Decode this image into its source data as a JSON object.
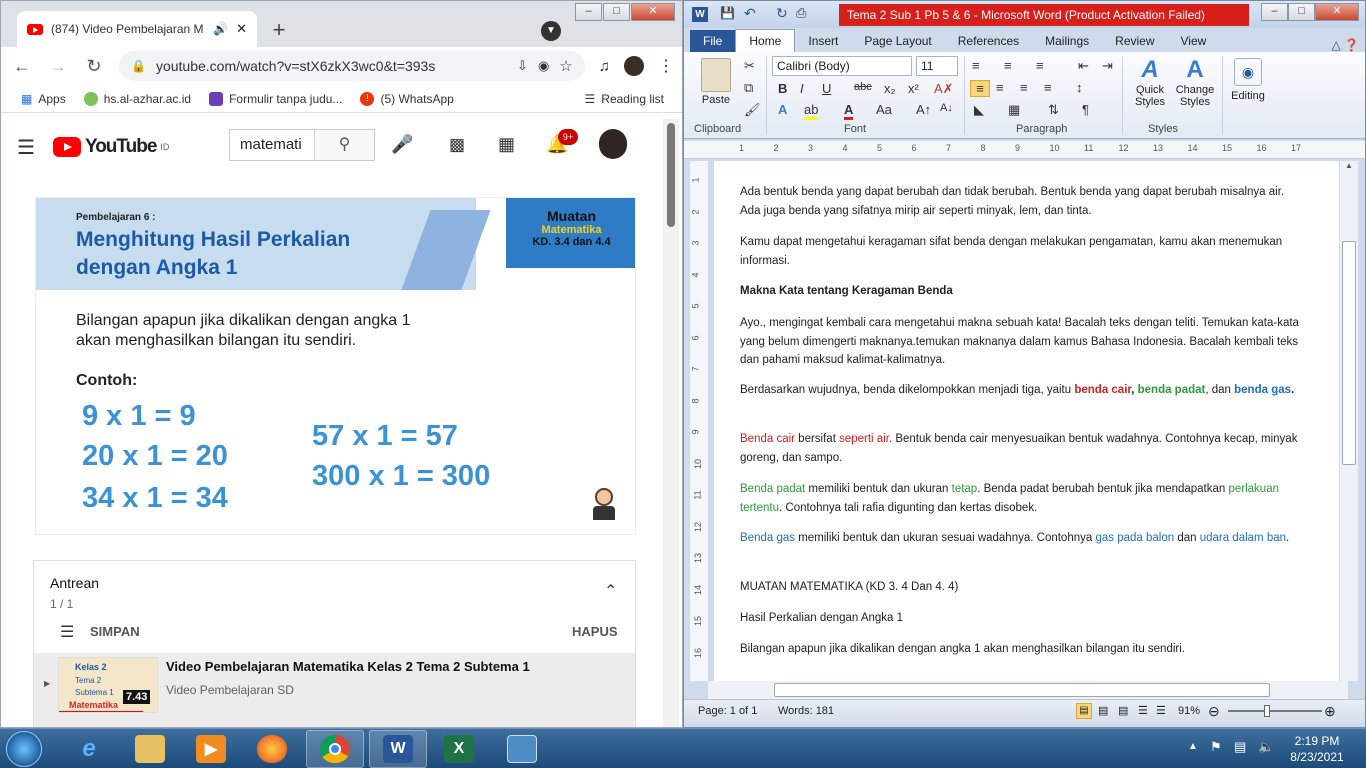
{
  "chrome": {
    "tab_title": "(874) Video Pembelajaran M",
    "new_tab": "+",
    "url": "youtube.com/watch?v=stX6zkX3wc0&t=393s",
    "bookmarks": [
      "Apps",
      "hs.al-azhar.ac.id",
      "Formulir tanpa judu...",
      "(5) WhatsApp"
    ],
    "reading_list": "Reading list",
    "window_controls": [
      "–",
      "□",
      "✕"
    ]
  },
  "youtube": {
    "logo_text": "YouTube",
    "region": "ID",
    "search_value": "matemati",
    "notif_count": "9+",
    "slide": {
      "kicker": "Pembelajaran 6 :",
      "title_line1": "Menghitung Hasil Perkalian",
      "title_line2": "dengan Angka 1",
      "muatan": "Muatan",
      "subject": "Matematika",
      "kd": "KD. 3.4 dan 4.4",
      "rule_line1": "Bilangan apapun jika dikalikan dengan angka 1",
      "rule_line2": "akan menghasilkan bilangan itu sendiri.",
      "contoh": "Contoh:",
      "examples_left": [
        "9 x 1 = 9",
        "20 x 1 = 20",
        "34 x 1 = 34"
      ],
      "examples_right": [
        "57 x 1 = 57",
        "300 x 1 = 300"
      ]
    },
    "queue": {
      "title": "Antrean",
      "position": "1 / 1",
      "save": "SIMPAN",
      "clear": "HAPUS",
      "item_title": "Video Pembelajaran Matematika Kelas 2 Tema 2 Subtema 1",
      "item_channel": "Video Pembelajaran SD",
      "item_duration": "7.43",
      "thumb_lines": [
        "Kelas 2",
        "Tema 2",
        "Subtema 1",
        "Matematika"
      ]
    }
  },
  "word": {
    "title": "Tema 2 Sub 1 Pb 5 & 6  -  Microsoft Word (Product Activation Failed)",
    "tabs": [
      "File",
      "Home",
      "Insert",
      "Page Layout",
      "References",
      "Mailings",
      "Review",
      "View"
    ],
    "font_name": "Calibri (Body)",
    "font_size": "11",
    "groups": [
      "Clipboard",
      "Font",
      "Paragraph",
      "Styles"
    ],
    "paste": "Paste",
    "quick_styles": [
      "Quick",
      "Styles"
    ],
    "change_styles": [
      "Change",
      "Styles"
    ],
    "editing": "Editing",
    "ruler_numbers": [
      "1",
      "2",
      "3",
      "4",
      "5",
      "6",
      "7",
      "8",
      "9",
      "10",
      "11",
      "12",
      "13",
      "14",
      "15",
      "16",
      "17"
    ],
    "vruler_numbers": [
      "1",
      "2",
      "3",
      "4",
      "5",
      "6",
      "7",
      "8",
      "9",
      "10",
      "11",
      "12",
      "13",
      "14",
      "15",
      "16"
    ],
    "doc": {
      "p1": "Ada bentuk benda yang dapat berubah dan tidak berubah. Bentuk benda yang dapat berubah misalnya air. Ada juga benda yang sifatnya mirip air seperti minyak, lem, dan tinta.",
      "p2": "Kamu dapat mengetahui keragaman sifat benda dengan melakukan pengamatan, kamu akan menemukan informasi.",
      "heading": "Makna Kata tentang Keragaman Benda",
      "p3": "Ayo., mengingat kembali cara mengetahui makna sebuah kata! Bacalah teks dengan teliti. Temukan kata-kata  yang belum dimengerti maknanya.temukan  maknanya dalam kamus Bahasa Indonesia. Bacalah kembali teks dan pahami maksud kalimat-kalimatnya.",
      "p4a": "Berdasarkan wujudnya, benda dikelompokkan menjadi tiga, yaitu ",
      "p4_cair": "benda cair",
      "p4_comma": ", ",
      "p4_padat": "benda padat",
      "p4_dan": ", dan ",
      "p4_gas": "benda gas",
      "p4_end": ".",
      "p5_a": "Benda cair",
      "p5_b": " bersifat ",
      "p5_c": "seperti air",
      "p5_d": ". Bentuk benda cair menyesuaikan bentuk wadahnya. Contohnya kecap, minyak goreng, dan sampo.",
      "p6_a": "Benda padat",
      "p6_b": " memiliki  bentuk dan ukuran ",
      "p6_c": "tetap",
      "p6_d": ". Benda padat berubah bentuk jika mendapatkan ",
      "p6_e": "perlakuan tertentu",
      "p6_f": ". Contohnya tali rafia digunting dan kertas disobek.",
      "p7_a": "Benda gas",
      "p7_b": " memiliki bentuk dan ukuran sesuai wadahnya. Contohnya ",
      "p7_c": "gas pada balon",
      "p7_d": " dan ",
      "p7_e": "udara dalam ban",
      "p7_f": ".",
      "p8": "MUATAN MATEMATIKA  (KD 3. 4 Dan 4. 4)",
      "p9": "Hasil Perkalian dengan Angka 1",
      "p10": "Bilangan apapun jika dikalikan dengan angka 1 akan menghasilkan bilangan itu sendiri."
    },
    "status": {
      "page": "Page: 1 of 1",
      "words": "Words: 181",
      "zoom": "91%"
    }
  },
  "taskbar": {
    "clock_time": "2:19 PM",
    "clock_date": "8/23/2021"
  }
}
